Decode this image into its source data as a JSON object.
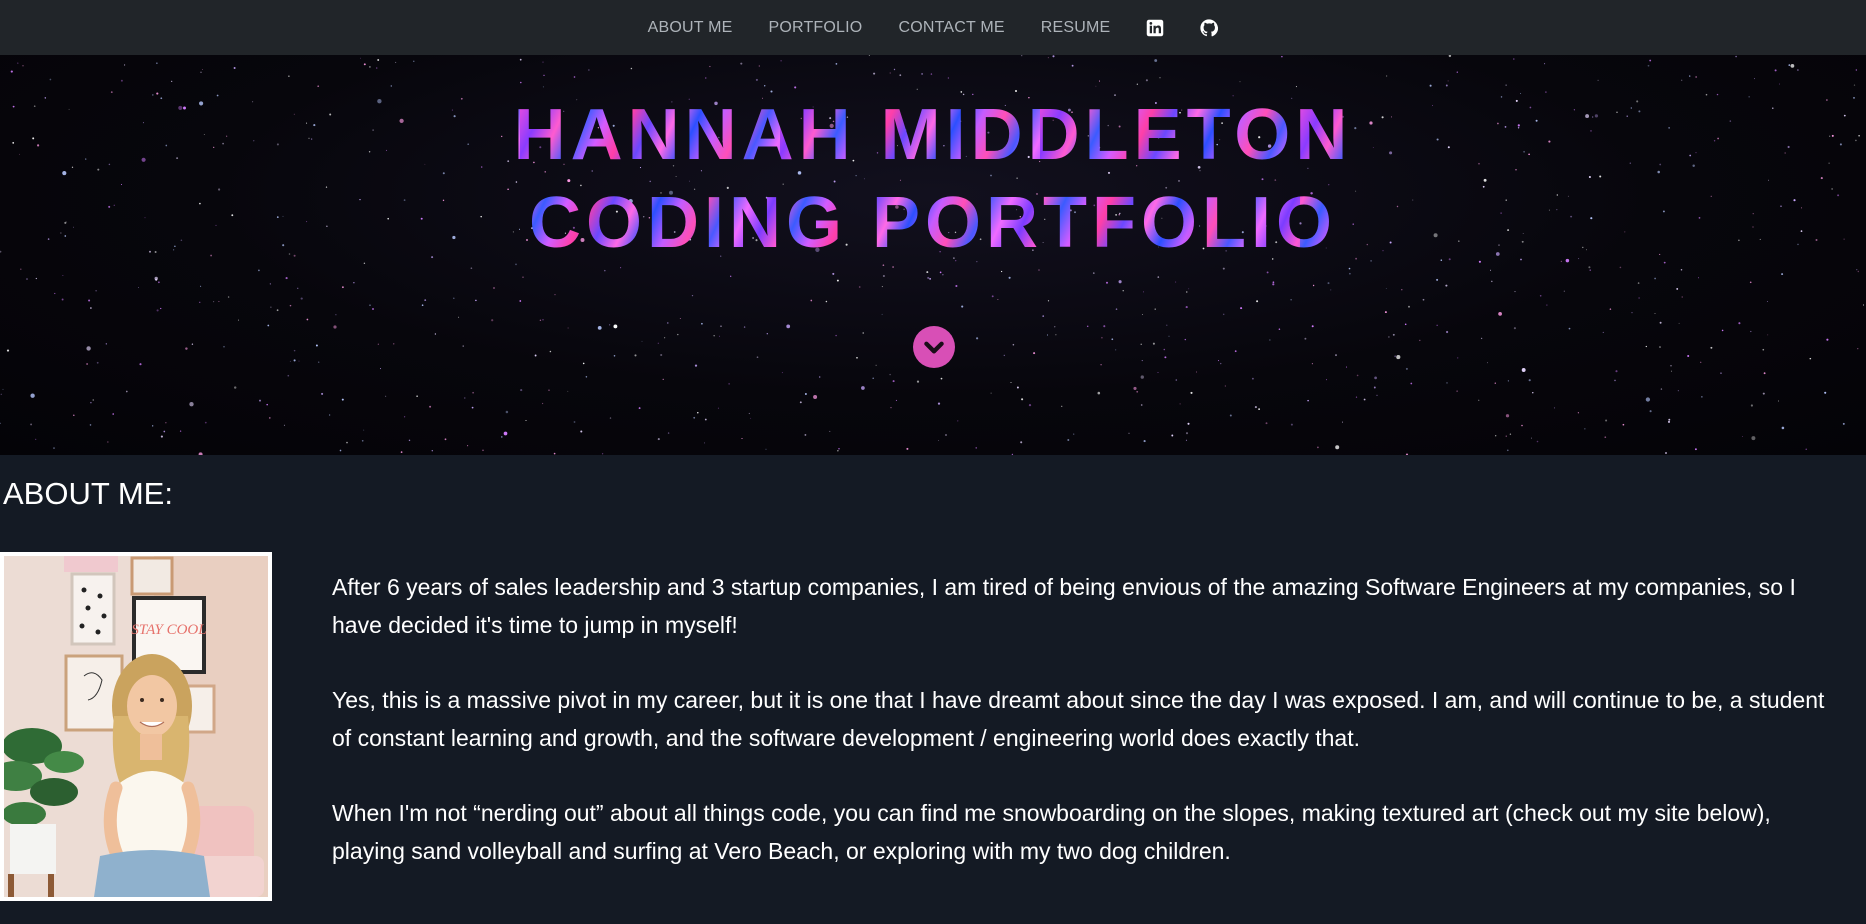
{
  "nav": {
    "items": [
      {
        "label": "ABOUT ME"
      },
      {
        "label": "PORTFOLIO"
      },
      {
        "label": "CONTACT ME"
      },
      {
        "label": "RESUME"
      }
    ],
    "icons": [
      "linkedin-icon",
      "github-icon"
    ]
  },
  "hero": {
    "title_line1": "HANNAH MIDDLETON",
    "title_line2": "CODING PORTFOLIO",
    "scroll_icon": "chevron-down-icon",
    "accent": "#d84fb6"
  },
  "about": {
    "heading": "ABOUT ME:",
    "paragraphs": [
      "After 6 years of sales leadership and 3 startup companies, I am tired of being envious of the amazing Software Engineers at my companies, so I have decided it's time to jump in myself!",
      "Yes, this is a massive pivot in my career, but it is one that I have dreamt about since the day I was exposed. I am, and will continue to be, a student of constant learning and growth, and the software development / engineering world does exactly that.",
      "When I'm not “nerding out” about all things code, you can find me snowboarding on the slopes, making textured art (check out my site below), playing sand volleyball and surfing at Vero Beach, or exploring with my two dog children."
    ],
    "photo_art_text": "STAY COOL"
  },
  "colors": {
    "navbar": "#212529",
    "page_bg": "#141a24",
    "nav_text": "#adb3b9"
  }
}
